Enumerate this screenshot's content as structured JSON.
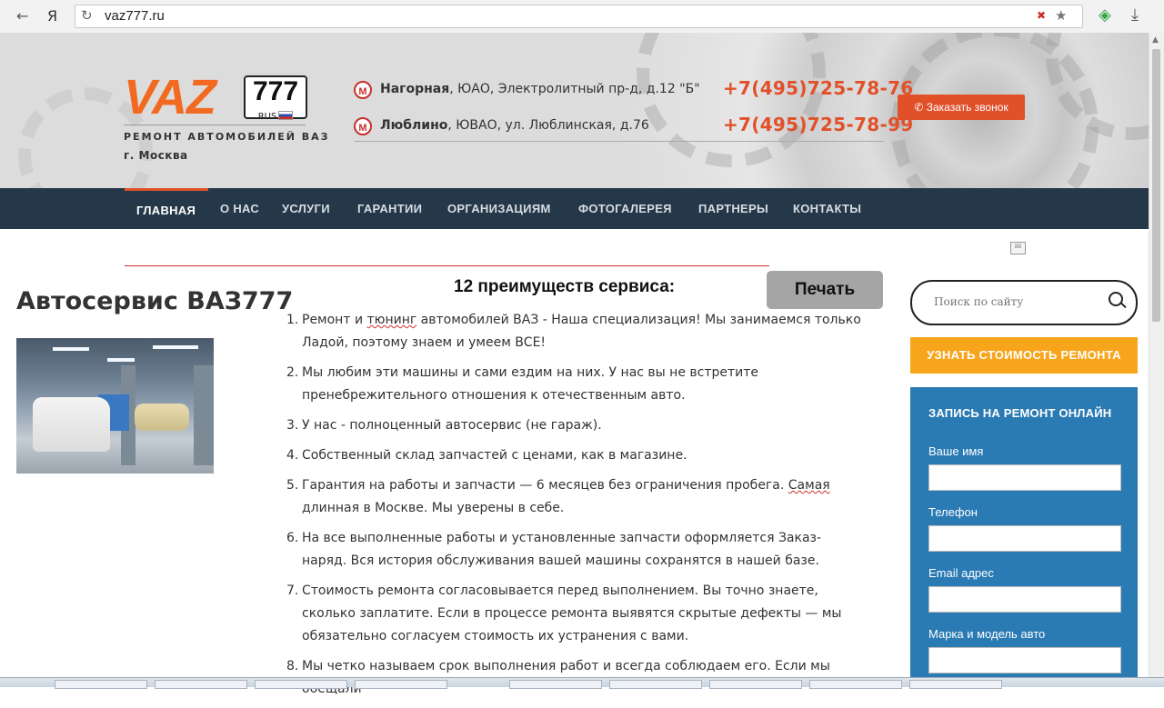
{
  "browser": {
    "back": "←",
    "yandex": "Я",
    "reload": "↻",
    "url": "vaz777.ru",
    "star": "★",
    "clear": "✖",
    "shield": "◈",
    "download": "⤓"
  },
  "header": {
    "logo_text": "VAZ",
    "plate_number": "777",
    "plate_region": "RUS",
    "tagline": "РЕМОНТ АВТОМОБИЛЕЙ ВАЗ",
    "city": "г. Москва",
    "metro_symbol": "М",
    "addresses": [
      {
        "station": "Нагорная",
        "rest": ", ЮАО, Электролитный пр-д, д.12 \"Б\"",
        "phone": "+7(495)725-78-76"
      },
      {
        "station": "Люблино",
        "rest": ", ЮВАО, ул. Люблинская, д.76",
        "phone": "+7(495)725-78-99"
      }
    ],
    "callback_label": "✆ Заказать звонок"
  },
  "nav": {
    "items": [
      "ГЛАВНАЯ",
      "О НАС",
      "УСЛУГИ",
      "ГАРАНТИИ",
      "ОРГАНИЗАЦИЯМ",
      "ФОТОГАЛЕРЕЯ",
      "ПАРТНЕРЫ",
      "КОНТАКТЫ"
    ],
    "active": "ГЛАВНАЯ"
  },
  "main": {
    "title": "Автосервис ВАЗ777",
    "print_label": "Печать",
    "list_title": "12 преимуществ сервиса:",
    "advantages": [
      {
        "n": "1.",
        "text_a": "Ремонт и ",
        "text_spell": "тюнинг",
        "text_b": " автомобилей ВАЗ - Наша специализация! Мы занимаемся только Ладой, поэтому знаем и умеем  ВСЕ!"
      },
      {
        "n": "2.",
        "text_a": "Мы любим эти машины и сами ездим на них. У нас вы не встретите пренебрежительного отношения к отечественным авто.",
        "text_spell": "",
        "text_b": ""
      },
      {
        "n": "3.",
        "text_a": "У нас - полноценный автосервис (не гараж).",
        "text_spell": "",
        "text_b": ""
      },
      {
        "n": "4.",
        "text_a": "Собственный склад запчастей с ценами, как в магазине.",
        "text_spell": "",
        "text_b": ""
      },
      {
        "n": "5.",
        "text_a": "Гарантия на работы и запчасти — 6 месяцев без ограничения пробега. ",
        "text_spell": "Самая",
        "text_b": " длинная в Москве. Мы уверены в себе."
      },
      {
        "n": "6.",
        "text_a": "На все выполненные работы и установленные запчасти оформляется Заказ-наряд. Вся история обслуживания вашей машины сохранятся в нашей базе.",
        "text_spell": "",
        "text_b": ""
      },
      {
        "n": "7.",
        "text_a": "Стоимость ремонта согласовывается перед выполнением. Вы точно знаете, сколько заплатите. Если в процессе ремонта выявятся скрытые дефекты — мы обязательно согласуем стоимость их устранения с вами.",
        "text_spell": "",
        "text_b": ""
      },
      {
        "n": "8.",
        "text_a": "Мы четко называем срок выполнения работ и всегда соблюдаем его. Если мы обещали",
        "text_spell": "",
        "text_b": ""
      }
    ]
  },
  "sidebar": {
    "search_placeholder": "Поиск по сайту",
    "cost_button": "УЗНАТЬ СТОИМОСТЬ РЕМОНТА",
    "form_title": "ЗАПИСЬ НА РЕМОНТ ОНЛАЙН",
    "fields": [
      "Ваше имя",
      "Телефон",
      "Email адрес",
      "Марка и модель авто"
    ]
  },
  "colors": {
    "accent": "#e2502a",
    "nav_bg": "#24384a",
    "form_bg": "#2a7ab3",
    "cost_btn": "#f7a51b"
  }
}
